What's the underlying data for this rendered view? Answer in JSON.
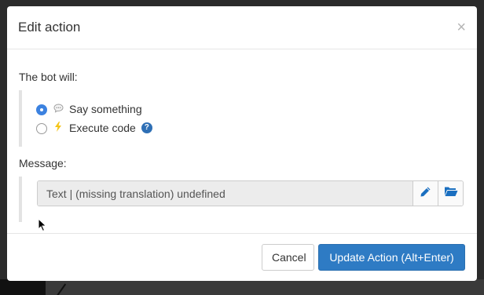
{
  "modal": {
    "title": "Edit action",
    "close_glyph": "×"
  },
  "body": {
    "bot_will_label": "The bot will:",
    "options": [
      {
        "label": "Say something",
        "icon": "speech-bubble-icon",
        "checked": true
      },
      {
        "label": "Execute code",
        "icon": "lightning-bolt-icon",
        "checked": false,
        "help": "?"
      }
    ],
    "message_label": "Message:",
    "message_value": "Text | (missing translation) undefined"
  },
  "footer": {
    "cancel_label": "Cancel",
    "submit_label": "Update Action (Alt+Enter)"
  },
  "colors": {
    "primary": "#2e7bc4",
    "radio_checked": "#3c82e0",
    "icon_blue": "#1a6fc0",
    "bolt": "#f5c518"
  }
}
